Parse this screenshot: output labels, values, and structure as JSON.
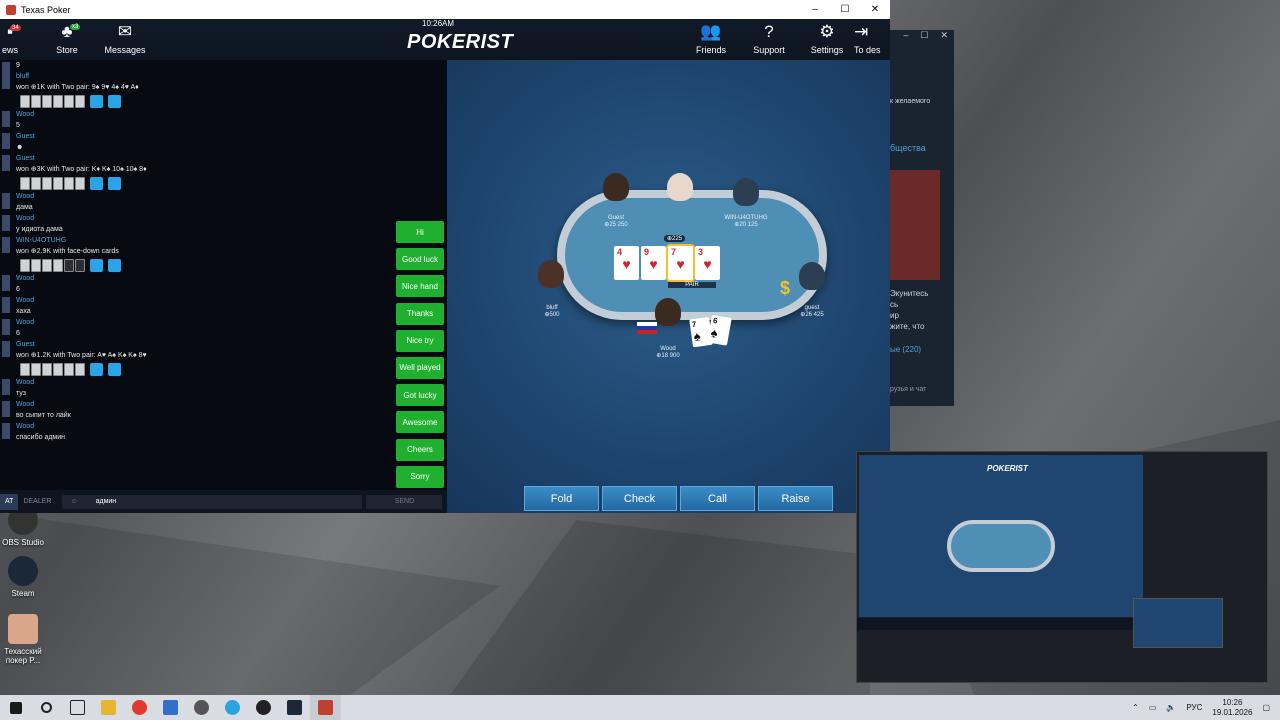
{
  "window": {
    "title": "Texas Poker",
    "controls": [
      "–",
      "☐",
      "✕"
    ]
  },
  "statusbar": {
    "time": "10:26AM"
  },
  "topnav": {
    "left": [
      {
        "id": "news",
        "label": "ews",
        "badge": "34"
      },
      {
        "id": "store",
        "label": "Store",
        "badge": "x3"
      },
      {
        "id": "messages",
        "label": "Messages"
      }
    ],
    "logo": "POKERIST",
    "right": [
      {
        "id": "friends",
        "label": "Friends"
      },
      {
        "id": "support",
        "label": "Support"
      },
      {
        "id": "settings",
        "label": "Settings"
      },
      {
        "id": "todesktop",
        "label": "To des"
      }
    ]
  },
  "chat": {
    "messages": [
      {
        "name": "",
        "text": "9"
      },
      {
        "name": "bluff",
        "text": "won ⊕1K with Two pair: 9♠ 9♥ 4♠ 4♥ A♦",
        "cards": 6,
        "dark": 0
      },
      {
        "name": "Wood",
        "text": "5"
      },
      {
        "name": "Guest",
        "text": "☻"
      },
      {
        "name": "Guest",
        "text": "won ⊕3K with Two pair: K♦ K♠ 10♠ 10♠ 8♦",
        "cards": 6,
        "dark": 0
      },
      {
        "name": "Wood",
        "text": "дама"
      },
      {
        "name": "Wood",
        "text": "у идиота дама"
      },
      {
        "name": "WIN-U4OTUHG",
        "text": "won ⊕2.9K with face-down cards",
        "cards": 6,
        "dark": 2
      },
      {
        "name": "Wood",
        "text": "6"
      },
      {
        "name": "Wood",
        "text": "хаха"
      },
      {
        "name": "Wood",
        "text": "6"
      },
      {
        "name": "Guest",
        "text": "won ⊕1.2K with Two pair: A♥ A♠ K♠ K♠ 8♥",
        "cards": 6,
        "dark": 0
      },
      {
        "name": "Wood",
        "text": "туз"
      },
      {
        "name": "Wood",
        "text": "во сыпит то лайк"
      },
      {
        "name": "Wood",
        "text": "спасибо админ"
      }
    ],
    "quick": [
      "Hi",
      "Good luck",
      "Nice hand",
      "Thanks",
      "Nice try",
      "Well played",
      "Got lucky",
      "Awesome",
      "Cheers",
      "Sorry"
    ],
    "tabs": [
      "AT",
      "DEALER"
    ],
    "input_value": "админ",
    "send_label": "SEND"
  },
  "table": {
    "pot": "⊕225",
    "board": [
      {
        "rank": "4",
        "suit": "♥"
      },
      {
        "rank": "9",
        "suit": "♥"
      },
      {
        "rank": "7",
        "suit": "♥"
      },
      {
        "rank": "3",
        "suit": "♥"
      }
    ],
    "hand_label": "PAIR",
    "players": [
      {
        "id": "guest-top",
        "name": "Guest",
        "chips": "⊕25 250"
      },
      {
        "id": "dealer",
        "name": "",
        "chips": ""
      },
      {
        "id": "win-player",
        "name": "WIN-U4OTUHG",
        "chips": "⊕20 125"
      },
      {
        "id": "bluff",
        "name": "bluff",
        "chips": "⊕500"
      },
      {
        "id": "guest-right",
        "name": "guest",
        "chips": "⊕26 425"
      },
      {
        "id": "wood",
        "name": "Wood",
        "chips": "⊕18 900"
      }
    ],
    "hero_cards": [
      {
        "rank": "7",
        "suit": "♠"
      },
      {
        "rank": "6",
        "suit": "♠"
      }
    ]
  },
  "actions": [
    "Fold",
    "Check",
    "Call",
    "Raise"
  ],
  "bg_window": {
    "lines": [
      "к желаемого",
      "бщества",
      "Экунитесь",
      "сь",
      "ир",
      "жите, что",
      "ые (220)",
      "рузья и чат"
    ]
  },
  "desktop_icons": [
    {
      "label": "OBS Studio"
    },
    {
      "label": "Steam"
    },
    {
      "label": "Техасский покер P..."
    }
  ],
  "tray": {
    "lang": "РУС",
    "time": "10:26",
    "date": "19.01.2026"
  }
}
